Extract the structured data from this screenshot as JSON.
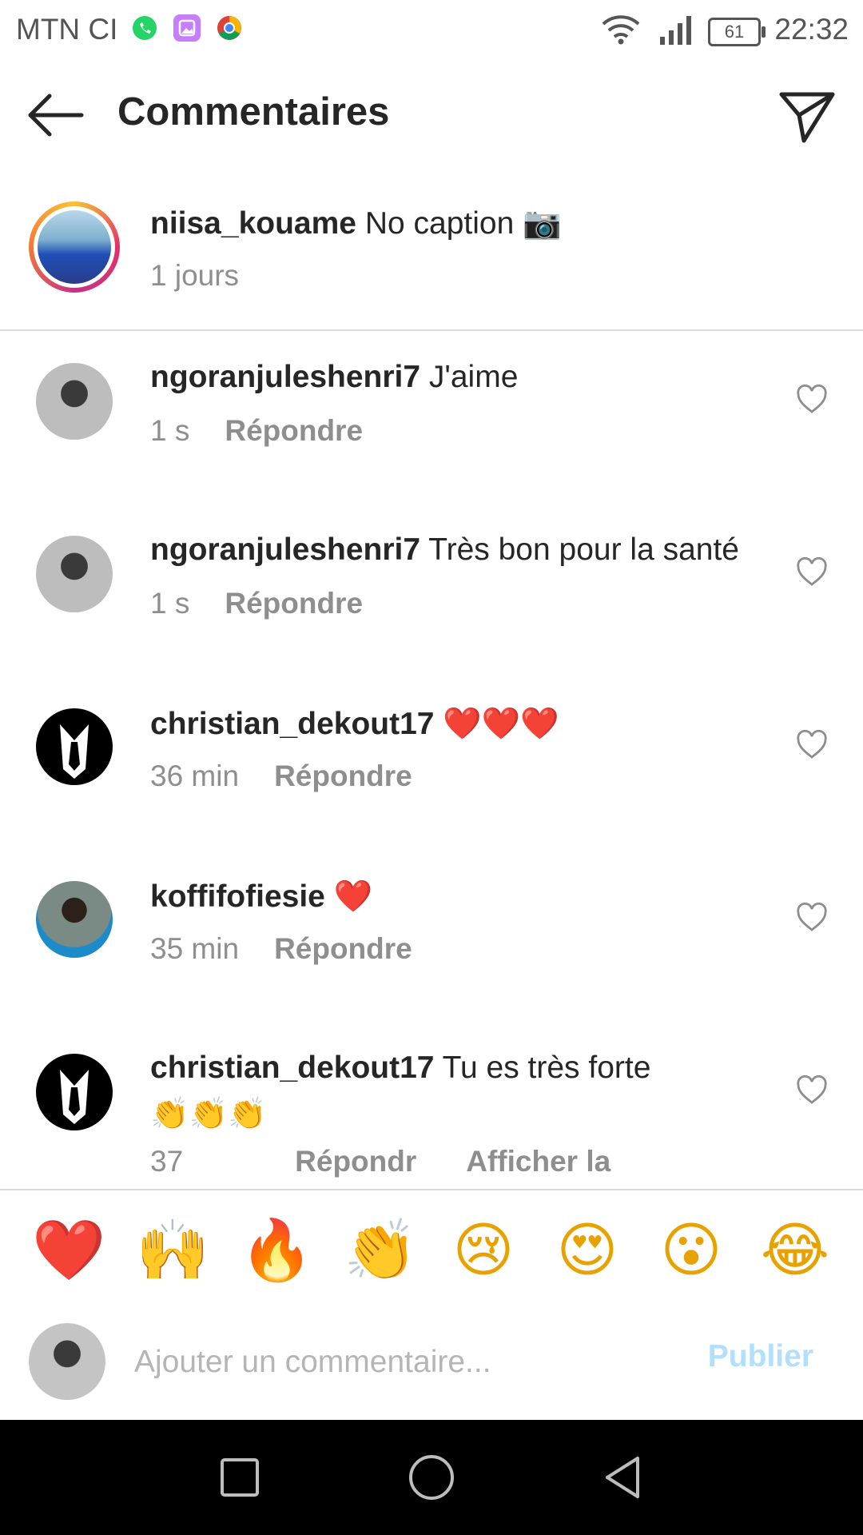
{
  "status_bar": {
    "carrier": "MTN CI",
    "battery": "61",
    "time": "22:32"
  },
  "header": {
    "title": "Commentaires"
  },
  "caption": {
    "username": "niisa_kouame",
    "text": "No caption 📷",
    "time": "1 jours"
  },
  "comments": [
    {
      "username": "ngoranjuleshenri7",
      "text": "J'aime",
      "time": "1 s",
      "reply": "Répondre"
    },
    {
      "username": "ngoranjuleshenri7",
      "text": "Très bon pour la santé",
      "time": "1 s",
      "reply": "Répondre"
    },
    {
      "username": "christian_dekout17",
      "text": "❤️❤️❤️",
      "time": "36 min",
      "reply": "Répondre"
    },
    {
      "username": "koffifofiesie",
      "text": "❤️",
      "time": "35 min",
      "reply": "Répondre"
    },
    {
      "username": "christian_dekout17",
      "text": "Tu es très forte",
      "text2": "👏👏👏",
      "time": "37",
      "reply": "Répondr",
      "extra": "Afficher la"
    }
  ],
  "emoji_bar": [
    "❤️",
    "🙌",
    "🔥",
    "👏",
    "😢",
    "😍",
    "😮",
    "😂"
  ],
  "composer": {
    "placeholder": "Ajouter un commentaire...",
    "publish_label": "Publier"
  },
  "colors": {
    "accent_disabled": "#b2dffc",
    "secondary_text": "#8e8e8e",
    "divider": "#dbdbdb"
  }
}
